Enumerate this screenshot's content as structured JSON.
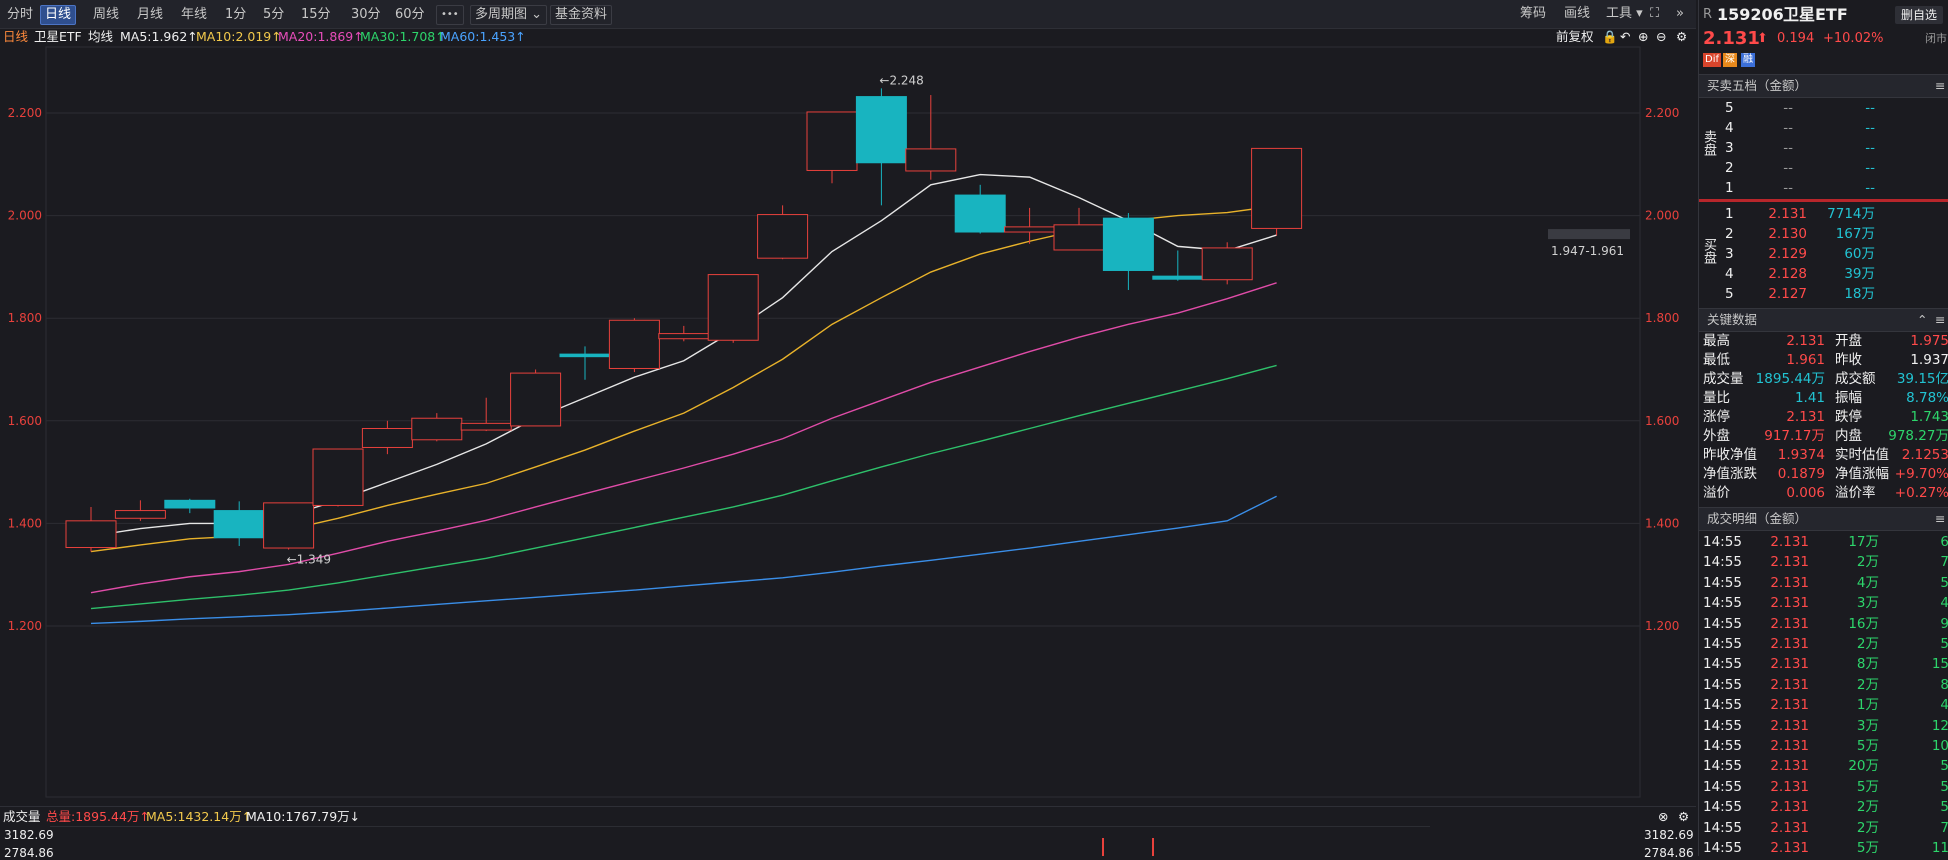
{
  "toolbar": {
    "tabs": [
      "分时",
      "日线",
      "周线",
      "月线",
      "年线",
      "1分",
      "5分",
      "15分",
      "30分",
      "60分",
      "•••",
      "多周期图 ⌄",
      "基金资料"
    ],
    "right_tools": [
      "筹码",
      "画线",
      "工具 ▾",
      "⛶",
      "»"
    ]
  },
  "ma_bar": {
    "period": "日线",
    "name": "卫星ETF",
    "ma_label": "均线",
    "ma5": "MA5:1.962↑",
    "ma10": "MA10:2.019↑",
    "ma20": "MA20:1.869↑",
    "ma30": "MA30:1.708↑",
    "ma60": "MA60:1.453↑",
    "fuquan": "前复权"
  },
  "chart_data": {
    "type": "candlestick",
    "title": "",
    "ylim": [
      1.16,
      2.29
    ],
    "y_ticks": [
      "2.200",
      "2.000",
      "1.800",
      "1.600",
      "1.400",
      "1.200"
    ],
    "y_tick_values": [
      2.2,
      2.0,
      1.8,
      1.6,
      1.4,
      1.2
    ],
    "candles": [
      {
        "o": 1.353,
        "h": 1.432,
        "l": 1.345,
        "c": 1.405,
        "up": true
      },
      {
        "o": 1.41,
        "h": 1.445,
        "l": 1.405,
        "c": 1.425,
        "up": true
      },
      {
        "o": 1.445,
        "h": 1.448,
        "l": 1.42,
        "c": 1.43,
        "up": false
      },
      {
        "o": 1.425,
        "h": 1.443,
        "l": 1.356,
        "c": 1.372,
        "up": false
      },
      {
        "o": 1.352,
        "h": 1.44,
        "l": 1.349,
        "c": 1.44,
        "up": true
      },
      {
        "o": 1.435,
        "h": 1.545,
        "l": 1.433,
        "c": 1.545,
        "up": true
      },
      {
        "o": 1.548,
        "h": 1.6,
        "l": 1.535,
        "c": 1.585,
        "up": true
      },
      {
        "o": 1.563,
        "h": 1.615,
        "l": 1.56,
        "c": 1.605,
        "up": true
      },
      {
        "o": 1.582,
        "h": 1.645,
        "l": 1.58,
        "c": 1.595,
        "up": true
      },
      {
        "o": 1.59,
        "h": 1.7,
        "l": 1.59,
        "c": 1.693,
        "up": true
      },
      {
        "o": 1.73,
        "h": 1.745,
        "l": 1.68,
        "c": 1.725,
        "up": false
      },
      {
        "o": 1.702,
        "h": 1.8,
        "l": 1.695,
        "c": 1.796,
        "up": true
      },
      {
        "o": 1.76,
        "h": 1.785,
        "l": 1.755,
        "c": 1.77,
        "up": true
      },
      {
        "o": 1.757,
        "h": 1.885,
        "l": 1.752,
        "c": 1.885,
        "up": true
      },
      {
        "o": 1.917,
        "h": 2.02,
        "l": 1.915,
        "c": 2.002,
        "up": true
      },
      {
        "o": 2.088,
        "h": 2.2,
        "l": 2.063,
        "c": 2.202,
        "up": true
      },
      {
        "o": 2.232,
        "h": 2.248,
        "l": 2.02,
        "c": 2.103,
        "up": false
      },
      {
        "o": 2.087,
        "h": 2.235,
        "l": 2.07,
        "c": 2.13,
        "up": true
      },
      {
        "o": 2.04,
        "h": 2.06,
        "l": 1.965,
        "c": 1.968,
        "up": false
      },
      {
        "o": 1.968,
        "h": 2.015,
        "l": 1.945,
        "c": 1.978,
        "up": true
      },
      {
        "o": 1.933,
        "h": 2.015,
        "l": 1.932,
        "c": 1.982,
        "up": true
      },
      {
        "o": 1.995,
        "h": 2.005,
        "l": 1.855,
        "c": 1.893,
        "up": false
      },
      {
        "o": 1.882,
        "h": 1.932,
        "l": 1.873,
        "c": 1.876,
        "up": false
      },
      {
        "o": 1.875,
        "h": 1.948,
        "l": 1.866,
        "c": 1.937,
        "up": true
      },
      {
        "o": 1.975,
        "h": 2.131,
        "l": 1.961,
        "c": 2.131,
        "up": true
      }
    ],
    "ma5": [
      1.375,
      1.39,
      1.4,
      1.4,
      1.415,
      1.445,
      1.48,
      1.515,
      1.555,
      1.605,
      1.645,
      1.685,
      1.717,
      1.775,
      1.84,
      1.93,
      1.99,
      2.06,
      2.08,
      2.075,
      2.035,
      1.99,
      1.94,
      1.932,
      1.962
    ],
    "ma10": [
      1.345,
      1.358,
      1.37,
      1.375,
      1.388,
      1.41,
      1.435,
      1.457,
      1.478,
      1.51,
      1.543,
      1.58,
      1.615,
      1.665,
      1.72,
      1.788,
      1.84,
      1.89,
      1.925,
      1.95,
      1.972,
      1.99,
      2.0,
      2.006,
      2.019
    ],
    "ma20": [
      1.265,
      1.282,
      1.296,
      1.306,
      1.32,
      1.342,
      1.365,
      1.385,
      1.406,
      1.432,
      1.458,
      1.483,
      1.508,
      1.535,
      1.565,
      1.605,
      1.64,
      1.675,
      1.705,
      1.735,
      1.763,
      1.788,
      1.81,
      1.838,
      1.869
    ],
    "ma30": [
      1.234,
      1.243,
      1.252,
      1.26,
      1.27,
      1.284,
      1.3,
      1.316,
      1.332,
      1.352,
      1.372,
      1.392,
      1.412,
      1.432,
      1.455,
      1.483,
      1.51,
      1.536,
      1.56,
      1.585,
      1.61,
      1.634,
      1.658,
      1.682,
      1.708
    ],
    "ma60": [
      1.205,
      1.209,
      1.214,
      1.218,
      1.222,
      1.228,
      1.235,
      1.242,
      1.249,
      1.256,
      1.263,
      1.27,
      1.278,
      1.286,
      1.294,
      1.305,
      1.317,
      1.328,
      1.34,
      1.352,
      1.365,
      1.378,
      1.391,
      1.405,
      1.453
    ],
    "annotations": [
      {
        "label": "←2.248",
        "candle": 16,
        "y": 2.248
      },
      {
        "label": "←1.349",
        "candle": 4,
        "y": 1.349
      }
    ],
    "range_label": "1.947-1.961",
    "colors": {
      "up": "#e8413c",
      "down": "#18b4c0",
      "ma5": "#e6e6e6",
      "ma10": "#e8b22a",
      "ma20": "#e04ca8",
      "ma30": "#2ec06a",
      "ma60": "#3a8ee8",
      "grid": "#2c2d33",
      "axis_label": "#e8413c"
    }
  },
  "volume_bar": {
    "label": "成交量",
    "total": "总量:1895.44万↑",
    "ma5": "MA5:1432.14万↑",
    "ma10": "MA10:1767.79万↓",
    "top_value": "3182.69",
    "sub_value": "2784.86"
  },
  "sidebar": {
    "code": "159206",
    "name": "卫星ETF",
    "r_label": "R",
    "self_select": "删自选",
    "price": "2.131",
    "change": "0.194",
    "change_pct": "+10.02%",
    "status": "闭市",
    "badges": [
      "Dif",
      "深",
      "融"
    ],
    "order_book_title": "买卖五档（金额）",
    "sell_label": "卖盘",
    "buy_label": "买盘",
    "sells": [
      {
        "level": "5",
        "price": "--",
        "amount": "--"
      },
      {
        "level": "4",
        "price": "--",
        "amount": "--"
      },
      {
        "level": "3",
        "price": "--",
        "amount": "--"
      },
      {
        "level": "2",
        "price": "--",
        "amount": "--"
      },
      {
        "level": "1",
        "price": "--",
        "amount": "--"
      }
    ],
    "buys": [
      {
        "level": "1",
        "price": "2.131",
        "amount": "7714万"
      },
      {
        "level": "2",
        "price": "2.130",
        "amount": "167万"
      },
      {
        "level": "3",
        "price": "2.129",
        "amount": "60万"
      },
      {
        "level": "4",
        "price": "2.128",
        "amount": "39万"
      },
      {
        "level": "5",
        "price": "2.127",
        "amount": "18万"
      }
    ],
    "key_data_title": "关键数据",
    "key_data": [
      {
        "l1": "最高",
        "v1": "2.131",
        "c1": "red",
        "l2": "开盘",
        "v2": "1.975",
        "c2": "red"
      },
      {
        "l1": "最低",
        "v1": "1.961",
        "c1": "red",
        "l2": "昨收",
        "v2": "1.937",
        "c2": "white"
      },
      {
        "l1": "成交量",
        "v1": "1895.44万",
        "c1": "cyan",
        "l2": "成交额",
        "v2": "39.15亿",
        "c2": "cyan"
      },
      {
        "l1": "量比",
        "v1": "1.41",
        "c1": "cyan",
        "l2": "振幅",
        "v2": "8.78%",
        "c2": "cyan"
      },
      {
        "l1": "涨停",
        "v1": "2.131",
        "c1": "red",
        "l2": "跌停",
        "v2": "1.743",
        "c2": "green"
      },
      {
        "l1": "外盘",
        "v1": "917.17万",
        "c1": "red",
        "l2": "内盘",
        "v2": "978.27万",
        "c2": "green"
      },
      {
        "l1": "昨收净值",
        "v1": "1.9374",
        "c1": "red",
        "l2": "实时估值",
        "v2": "2.1253",
        "c2": "red"
      },
      {
        "l1": "净值涨跌",
        "v1": "0.1879",
        "c1": "red",
        "l2": "净值涨幅",
        "v2": "+9.70%",
        "c2": "red"
      },
      {
        "l1": "溢价",
        "v1": "0.006",
        "c1": "red",
        "l2": "溢价率",
        "v2": "+0.27%",
        "c2": "red"
      }
    ],
    "trades_title": "成交明细（金额）",
    "trades": [
      {
        "time": "14:55",
        "price": "2.131",
        "amount": "17万",
        "n": "6"
      },
      {
        "time": "14:55",
        "price": "2.131",
        "amount": "2万",
        "n": "7"
      },
      {
        "time": "14:55",
        "price": "2.131",
        "amount": "4万",
        "n": "5"
      },
      {
        "time": "14:55",
        "price": "2.131",
        "amount": "3万",
        "n": "4"
      },
      {
        "time": "14:55",
        "price": "2.131",
        "amount": "16万",
        "n": "9"
      },
      {
        "time": "14:55",
        "price": "2.131",
        "amount": "2万",
        "n": "5"
      },
      {
        "time": "14:55",
        "price": "2.131",
        "amount": "8万",
        "n": "15"
      },
      {
        "time": "14:55",
        "price": "2.131",
        "amount": "2万",
        "n": "8"
      },
      {
        "time": "14:55",
        "price": "2.131",
        "amount": "1万",
        "n": "4"
      },
      {
        "time": "14:55",
        "price": "2.131",
        "amount": "3万",
        "n": "12"
      },
      {
        "time": "14:55",
        "price": "2.131",
        "amount": "5万",
        "n": "10"
      },
      {
        "time": "14:55",
        "price": "2.131",
        "amount": "20万",
        "n": "5"
      },
      {
        "time": "14:55",
        "price": "2.131",
        "amount": "5万",
        "n": "5"
      },
      {
        "time": "14:55",
        "price": "2.131",
        "amount": "2万",
        "n": "5"
      },
      {
        "time": "14:55",
        "price": "2.131",
        "amount": "2万",
        "n": "7"
      },
      {
        "time": "14:55",
        "price": "2.131",
        "amount": "5万",
        "n": "11"
      }
    ]
  }
}
